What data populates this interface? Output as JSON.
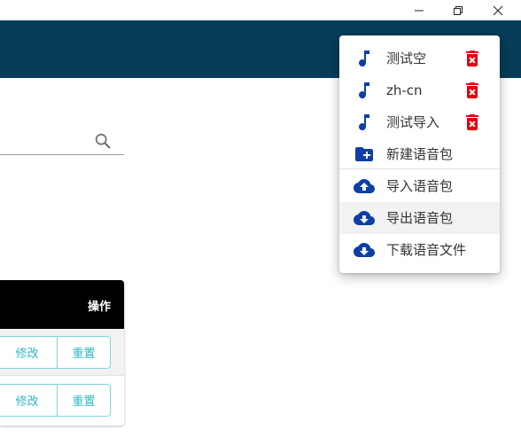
{
  "colors": {
    "header": "#063d58",
    "menu_icon": "#0d3fa6",
    "delete_icon": "#e3000f",
    "table_button": "#2ab7c9"
  },
  "window": {
    "minimize_icon": "minimize-icon",
    "maximize_icon": "restore-icon",
    "close_icon": "close-icon"
  },
  "search": {
    "value": "",
    "placeholder": "",
    "icon": "search-icon"
  },
  "table": {
    "header_action": "操作",
    "rows": [
      {
        "edit_label": "修改",
        "reset_label": "重置"
      },
      {
        "edit_label": "修改",
        "reset_label": "重置"
      }
    ]
  },
  "menu": {
    "packs": [
      {
        "label": "测试空",
        "icon": "music-note-icon",
        "delete_icon": "delete-icon"
      },
      {
        "label": "zh-cn",
        "icon": "music-note-icon",
        "delete_icon": "delete-icon"
      },
      {
        "label": "测试导入",
        "icon": "music-note-icon",
        "delete_icon": "delete-icon"
      }
    ],
    "new_pack": {
      "label": "新建语音包",
      "icon": "folder-add-icon"
    },
    "actions": [
      {
        "label": "导入语音包",
        "icon": "cloud-upload-icon"
      },
      {
        "label": "导出语音包",
        "icon": "cloud-download-icon"
      },
      {
        "label": "下载语音文件",
        "icon": "cloud-download-icon"
      }
    ]
  }
}
